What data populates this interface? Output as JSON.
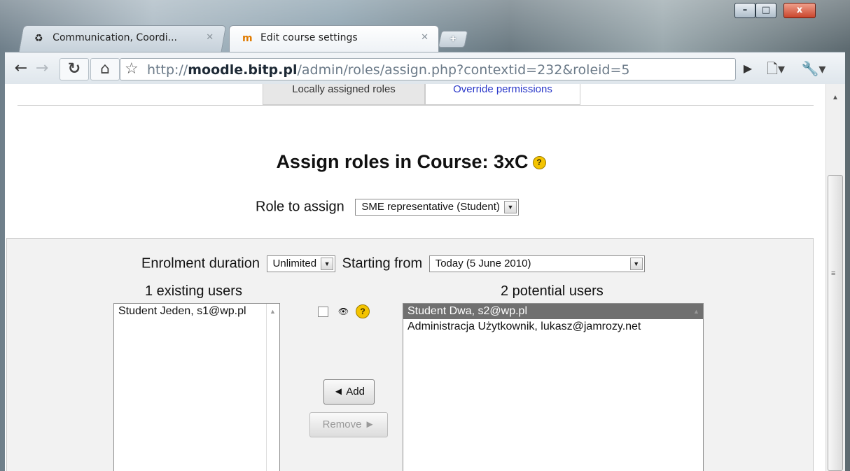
{
  "browser": {
    "tabs": [
      {
        "label": "Communication, Coordi...",
        "icon": "moodle-icon",
        "active": false
      },
      {
        "label": "Edit course settings",
        "icon": "moodle-icon",
        "active": true
      }
    ],
    "new_tab_symbol": "+",
    "window_controls": {
      "minimize": "–",
      "maximize": "□",
      "close": "x"
    },
    "address": {
      "prefix": "http://",
      "domain": "moodle.bitp.pl",
      "path": "/admin/roles/assign.php?contextid=232&roleid=5"
    }
  },
  "page": {
    "tabs": [
      {
        "label": "Locally assigned roles",
        "active": true
      },
      {
        "label": "Override permissions",
        "active": false
      }
    ],
    "title": "Assign roles in Course: 3xC",
    "help_icon_glyph": "?",
    "role": {
      "label": "Role to assign",
      "selected": "SME representative (Student)"
    },
    "enrolment": {
      "duration_label": "Enrolment duration",
      "duration_value": "Unlimited",
      "start_label": "Starting from",
      "start_value": "Today (5 June 2010)"
    },
    "existing": {
      "heading": "1 existing users",
      "users": [
        "Student Jeden, s1@wp.pl"
      ]
    },
    "potential": {
      "heading": "2 potential users",
      "users": [
        "Student Dwa, s2@wp.pl",
        "Administracja Użytkownik, lukasz@jamrozy.net"
      ],
      "selected_index": 0
    },
    "actions": {
      "add": "◄ Add",
      "remove": "Remove ►"
    }
  }
}
